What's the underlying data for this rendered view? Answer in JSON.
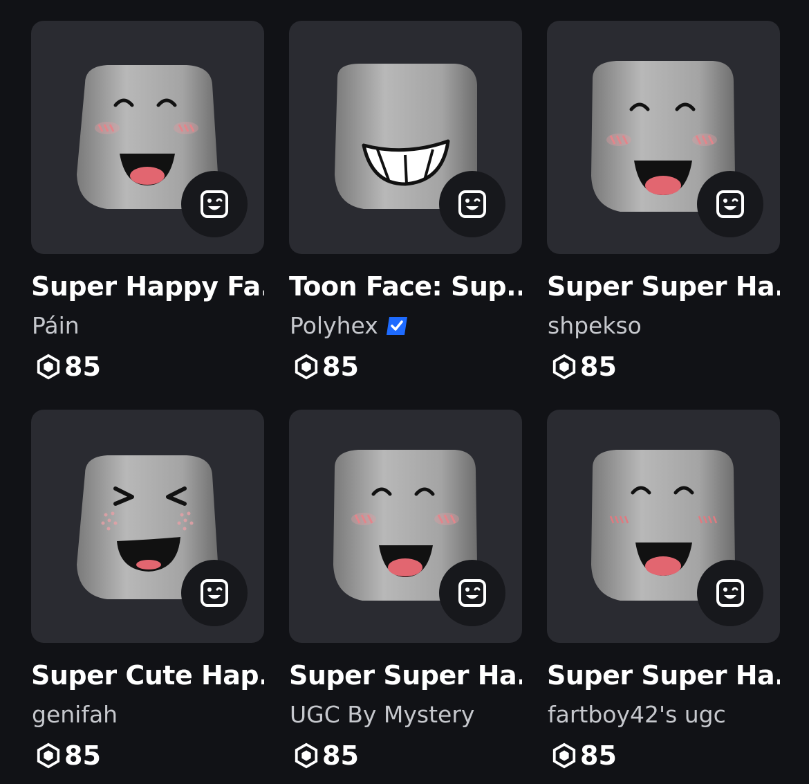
{
  "items": [
    {
      "title": "Super Happy Fa...",
      "creator": "Páin",
      "verified": false,
      "price": "85",
      "face": "happy-blush"
    },
    {
      "title": "Toon Face: Sup...",
      "creator": "Polyhex",
      "verified": true,
      "price": "85",
      "face": "toon-grin"
    },
    {
      "title": "Super Super Ha...",
      "creator": "shpekso",
      "verified": false,
      "price": "85",
      "face": "happy-blush"
    },
    {
      "title": "Super Cute Hap...",
      "creator": "genifah",
      "verified": false,
      "price": "85",
      "face": "squint-happy"
    },
    {
      "title": "Super Super Ha...",
      "creator": "UGC By Mystery",
      "verified": false,
      "price": "85",
      "face": "happy-blush"
    },
    {
      "title": "Super Super Ha...",
      "creator": "fartboy42's ugc",
      "verified": false,
      "price": "85",
      "face": "happy-blush"
    }
  ],
  "colors": {
    "background": "#111216",
    "card": "#2a2b31",
    "badge": "#17181c",
    "verified": "#1e6bff",
    "creator_text": "#c6c8cd"
  },
  "icons": {
    "badge": "dynamic-head-icon",
    "currency": "robux-icon",
    "verified": "verified-badge-icon"
  }
}
